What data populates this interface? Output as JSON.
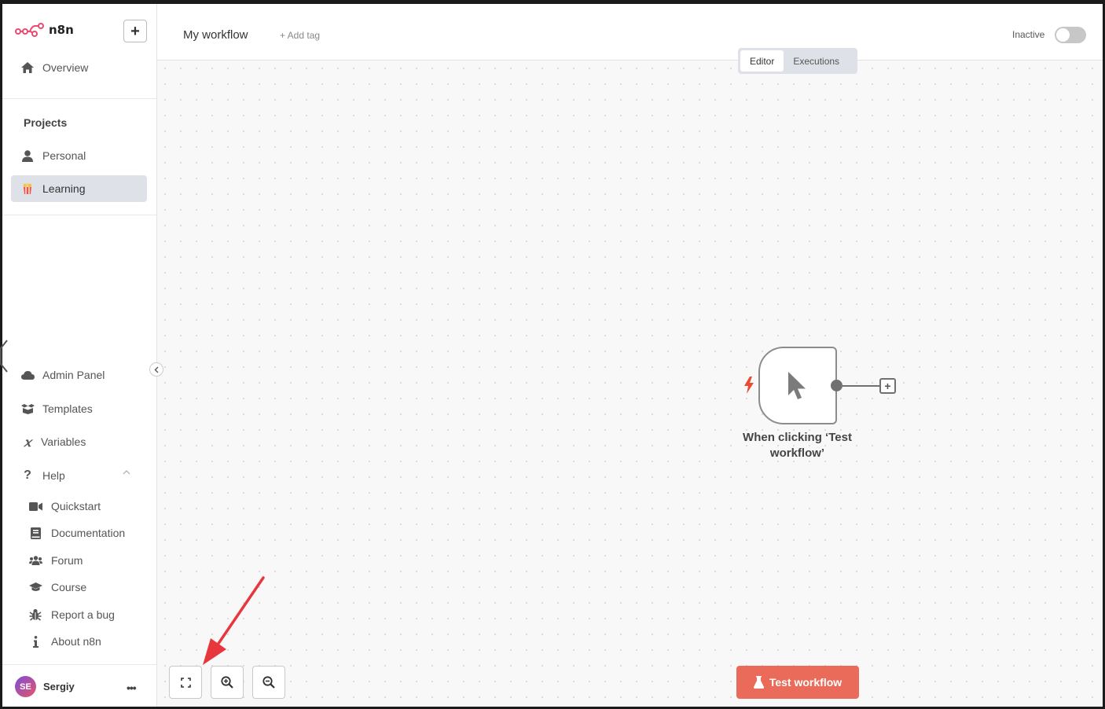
{
  "app": {
    "logo_text": "n8n",
    "add_button_label": "+"
  },
  "sidebar": {
    "overview_label": "Overview",
    "projects_title": "Projects",
    "projects": [
      {
        "label": "Personal",
        "icon": "user-icon"
      },
      {
        "label": "Learning",
        "icon": "popcorn-icon",
        "active": true
      }
    ],
    "bottom_items": [
      {
        "label": "Admin Panel",
        "icon": "cloud-icon"
      },
      {
        "label": "Templates",
        "icon": "box-open-icon"
      },
      {
        "label": "Variables",
        "icon": "variable-icon"
      },
      {
        "label": "Help",
        "icon": "question-icon"
      }
    ],
    "help_items": [
      {
        "label": "Quickstart",
        "icon": "video-icon"
      },
      {
        "label": "Documentation",
        "icon": "book-icon"
      },
      {
        "label": "Forum",
        "icon": "users-icon"
      },
      {
        "label": "Course",
        "icon": "graduation-cap-icon"
      },
      {
        "label": "Report a bug",
        "icon": "bug-icon"
      },
      {
        "label": "About n8n",
        "icon": "info-icon"
      }
    ],
    "user": {
      "initials": "SE",
      "name": "Sergiy",
      "more": "•••"
    }
  },
  "header": {
    "workflow_name": "My workflow",
    "add_tag": "+ Add tag",
    "status_label": "Inactive",
    "tabs": [
      {
        "label": "Editor",
        "active": true
      },
      {
        "label": "Executions",
        "active": false
      }
    ]
  },
  "canvas": {
    "node_label": "When clicking ‘Test workflow’",
    "test_button_label": "Test workflow"
  },
  "colors": {
    "accent": "#ea6b59",
    "trigger_bolt": "#ea4b33",
    "annotation_arrow": "#e8363d"
  }
}
